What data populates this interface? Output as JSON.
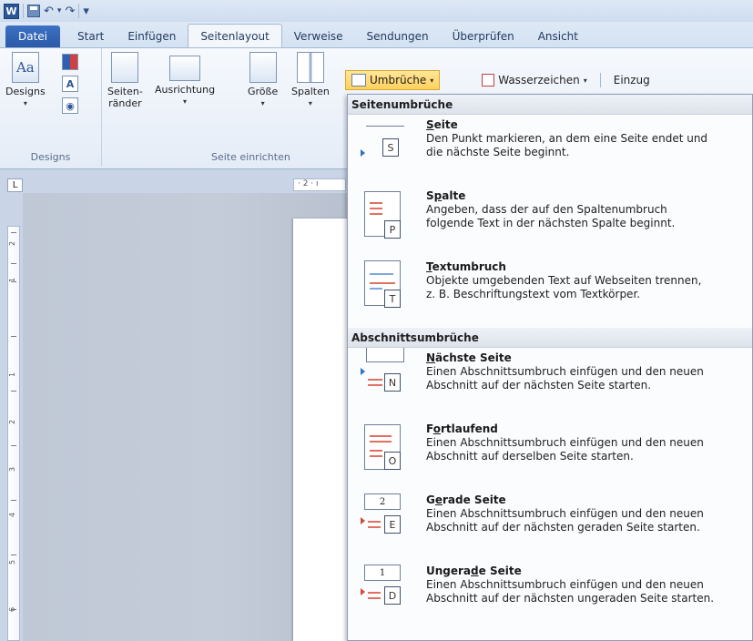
{
  "qat": {
    "logo": "W",
    "save_icon": "save-icon",
    "undo_glyph": "↶",
    "redo_glyph": "↷",
    "customize_glyph": "▾"
  },
  "tabs": [
    {
      "label": "Datei"
    },
    {
      "label": "Start"
    },
    {
      "label": "Einfügen"
    },
    {
      "label": "Seitenlayout"
    },
    {
      "label": "Verweise"
    },
    {
      "label": "Sendungen"
    },
    {
      "label": "Überprüfen"
    },
    {
      "label": "Ansicht"
    }
  ],
  "ribbon": {
    "designs": {
      "label": "Designs",
      "group": "Designs",
      "big_icon_text": "Aa"
    },
    "page_setup": {
      "margins": "Seiten-\nränder",
      "orientation": "Ausrichtung",
      "size": "Größe",
      "columns": "Spalten",
      "group": "Seite einrichten"
    },
    "breaks": "Umbrüche",
    "watermark": "Wasserzeichen",
    "indent": "Einzug"
  },
  "ruler": {
    "corner": "L",
    "top": "· 2 · ı",
    "left_numbers": [
      "2",
      "1",
      "1",
      "2",
      "3",
      "4",
      "5",
      "6"
    ]
  },
  "dropdown": {
    "page_breaks_header": "Seitenumbrüche",
    "section_breaks_header": "Abschnittsumbrüche",
    "page_items": [
      {
        "title_pre": "",
        "title_acc": "S",
        "title_post": "eite",
        "letter": "S",
        "desc1": "Den Punkt markieren, an dem eine Seite endet und",
        "desc2": "die nächste Seite beginnt."
      },
      {
        "title_pre": "S",
        "title_acc": "p",
        "title_post": "alte",
        "letter": "P",
        "desc1": "Angeben, dass der auf den Spaltenumbruch",
        "desc2": "folgende Text in der nächsten Spalte beginnt."
      },
      {
        "title_pre": "",
        "title_acc": "T",
        "title_post": "extumbruch",
        "letter": "T",
        "desc1": "Objekte umgebenden Text auf Webseiten trennen,",
        "desc2": "z. B. Beschriftungstext vom Textkörper."
      }
    ],
    "section_items": [
      {
        "title_pre": "",
        "title_acc": "N",
        "title_post": "ächste Seite",
        "letter": "N",
        "desc1": "Einen Abschnittsumbruch einfügen und den neuen",
        "desc2": "Abschnitt auf der nächsten Seite starten."
      },
      {
        "title_pre": "F",
        "title_acc": "o",
        "title_post": "rtlaufend",
        "letter": "O",
        "desc1": "Einen Abschnittsumbruch einfügen und den neuen",
        "desc2": "Abschnitt auf derselben Seite starten."
      },
      {
        "title_pre": "G",
        "title_acc": "e",
        "title_post": "rade Seite",
        "letter": "E",
        "num": "2",
        "desc1": "Einen Abschnittsumbruch einfügen und den neuen",
        "desc2": "Abschnitt auf der nächsten geraden Seite starten."
      },
      {
        "title_pre": "Ungera",
        "title_acc": "d",
        "title_post": "e Seite",
        "letter": "D",
        "num": "1",
        "desc1": "Einen Abschnittsumbruch einfügen und den neuen",
        "desc2": "Abschnitt auf der nächsten ungeraden Seite starten."
      }
    ]
  },
  "colors": {
    "file_tab": "#2a5aa8",
    "selected_button": "#ffd25c",
    "accent_red": "#e07060"
  }
}
